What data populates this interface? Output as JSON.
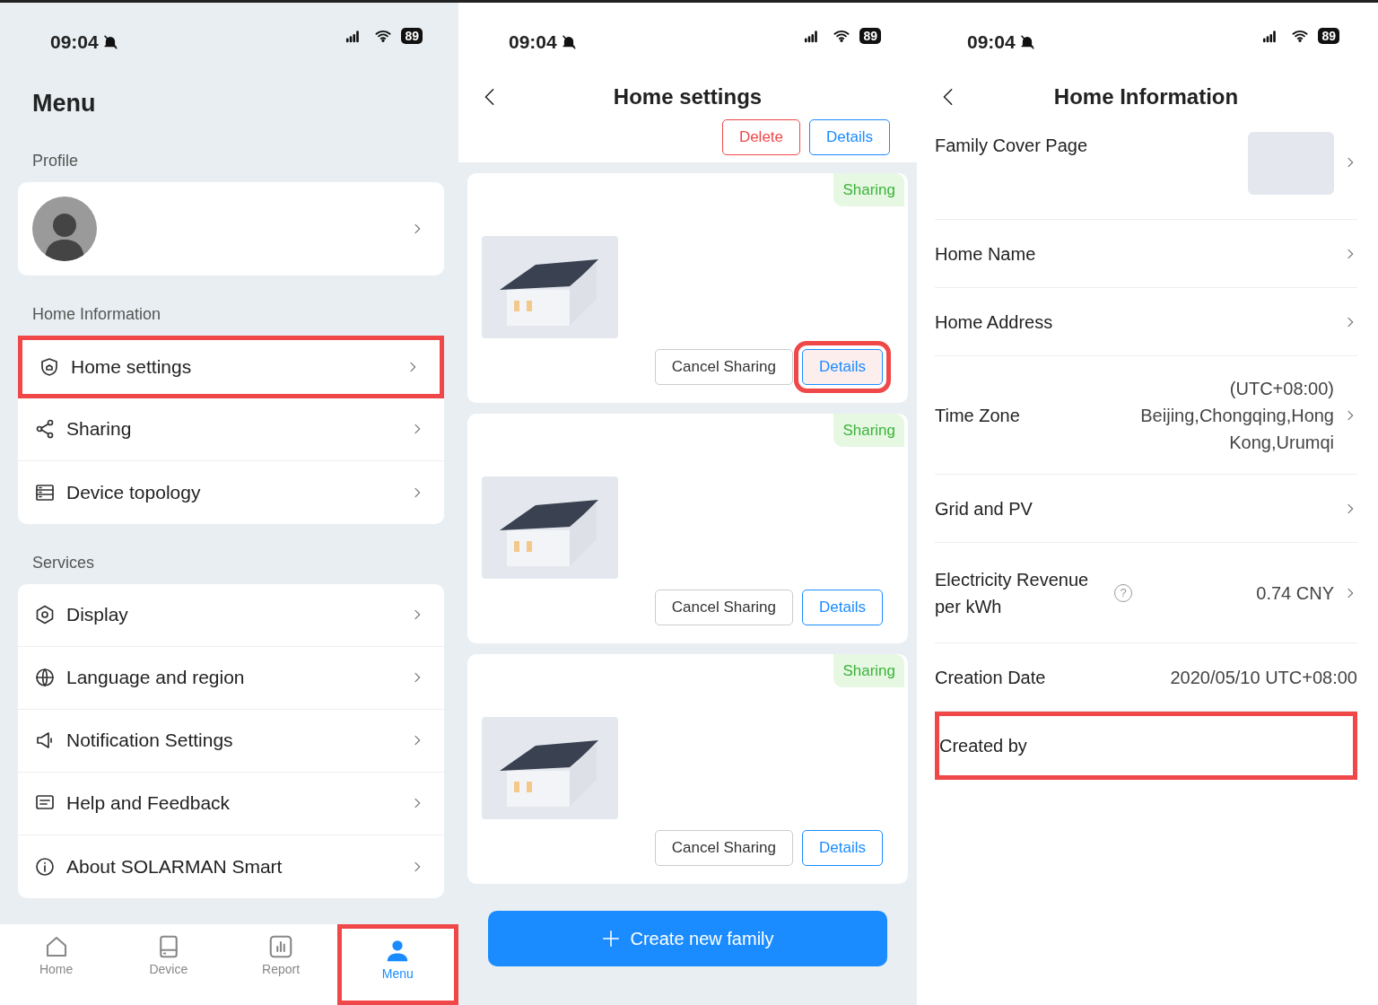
{
  "screens": [
    {
      "status_bar": {
        "time": "09:04",
        "battery": "89"
      },
      "title": "Menu",
      "sections": [
        {
          "heading": "Profile",
          "kind": "profile"
        },
        {
          "heading": "Home Information",
          "kind": "list",
          "items": [
            {
              "label": "Home settings",
              "highlighted": true
            },
            {
              "label": "Sharing",
              "highlighted": false
            },
            {
              "label": "Device topology",
              "highlighted": false
            }
          ]
        },
        {
          "heading": "Services",
          "kind": "list",
          "items": [
            {
              "label": "Display",
              "highlighted": false
            },
            {
              "label": "Language and region",
              "highlighted": false
            },
            {
              "label": "Notification Settings",
              "highlighted": false
            },
            {
              "label": "Help and Feedback",
              "highlighted": false
            },
            {
              "label": "About SOLARMAN Smart",
              "highlighted": false
            }
          ]
        }
      ],
      "bottom_nav": [
        {
          "label": "Home",
          "selected": false,
          "highlighted": false
        },
        {
          "label": "Device",
          "selected": false,
          "highlighted": false
        },
        {
          "label": "Report",
          "selected": false,
          "highlighted": false
        },
        {
          "label": "Menu",
          "selected": true,
          "highlighted": true
        }
      ]
    },
    {
      "status_bar": {
        "time": "09:04",
        "battery": "89"
      },
      "title": "Home settings",
      "top_buttons": [
        {
          "label": "Delete",
          "kind": "danger"
        },
        {
          "label": "Details",
          "kind": "primary"
        }
      ],
      "families": [
        {
          "badge": "Sharing",
          "buttons": [
            {
              "label": "Cancel Sharing",
              "kind": "secondary",
              "highlighted": false
            },
            {
              "label": "Details",
              "kind": "primary",
              "highlighted": true
            }
          ]
        },
        {
          "badge": "Sharing",
          "buttons": [
            {
              "label": "Cancel Sharing",
              "kind": "secondary",
              "highlighted": false
            },
            {
              "label": "Details",
              "kind": "primary",
              "highlighted": false
            }
          ]
        },
        {
          "badge": "Sharing",
          "buttons": [
            {
              "label": "Cancel Sharing",
              "kind": "secondary",
              "highlighted": false
            },
            {
              "label": "Details",
              "kind": "primary",
              "highlighted": false
            }
          ]
        }
      ],
      "create_button": "Create new family"
    },
    {
      "status_bar": {
        "time": "09:04",
        "battery": "89"
      },
      "title": "Home Information",
      "rows": [
        {
          "label": "Family Cover Page",
          "kind": "picture",
          "chevron": true,
          "highlighted": false
        },
        {
          "label": "Home Name",
          "kind": "text",
          "chevron": true,
          "highlighted": false
        },
        {
          "label": "Home Address",
          "kind": "text",
          "chevron": true,
          "highlighted": false
        },
        {
          "label": "Time Zone",
          "kind": "text",
          "value": "(UTC+08:00) Beijing,Chongqing,Hong Kong,Urumqi",
          "chevron": true,
          "highlighted": false
        },
        {
          "label": "Grid and PV",
          "kind": "text",
          "chevron": true,
          "highlighted": false
        },
        {
          "label": "Electricity Revenue per kWh",
          "kind": "help",
          "help": "?",
          "value": "0.74 CNY",
          "chevron": true,
          "highlighted": false
        },
        {
          "label": "Creation Date",
          "kind": "text",
          "value": "2020/05/10 UTC+08:00",
          "chevron": false,
          "highlighted": false
        },
        {
          "label": "Created by",
          "kind": "text",
          "chevron": false,
          "highlighted": true
        }
      ]
    }
  ]
}
